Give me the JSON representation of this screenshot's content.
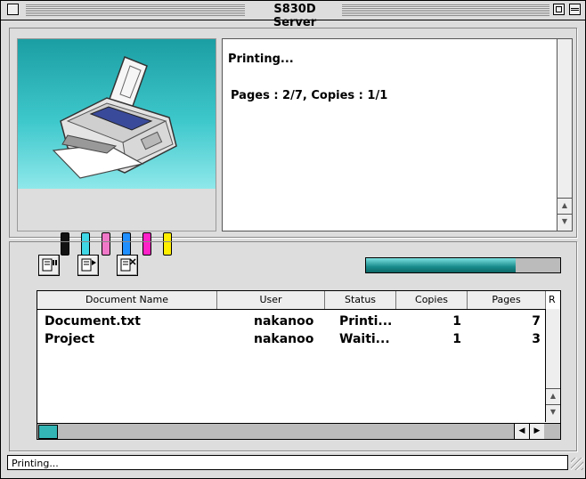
{
  "window": {
    "title": "S830D Server"
  },
  "message": {
    "line1": "Printing...",
    "line2": "Pages : 2/7, Copies : 1/1"
  },
  "ink_colors": [
    "#111111",
    "#3fd6e6",
    "#f078c8",
    "#1f8fff",
    "#ff21c8",
    "#ffee00"
  ],
  "toolbar": {
    "pause_icon": "pause-job-icon",
    "resume_icon": "resume-job-icon",
    "delete_icon": "delete-job-icon"
  },
  "progress": {
    "fraction": 0.77
  },
  "table": {
    "columns": [
      "Document Name",
      "User",
      "Status",
      "Copies",
      "Pages",
      "R"
    ],
    "rows": [
      {
        "document": "Document.txt",
        "user": "nakanoo",
        "status": "Printi...",
        "copies": "1",
        "pages": "7"
      },
      {
        "document": "Project",
        "user": "nakanoo",
        "status": "Waiti...",
        "copies": "1",
        "pages": "3"
      }
    ]
  },
  "status": {
    "text": "Printing..."
  }
}
